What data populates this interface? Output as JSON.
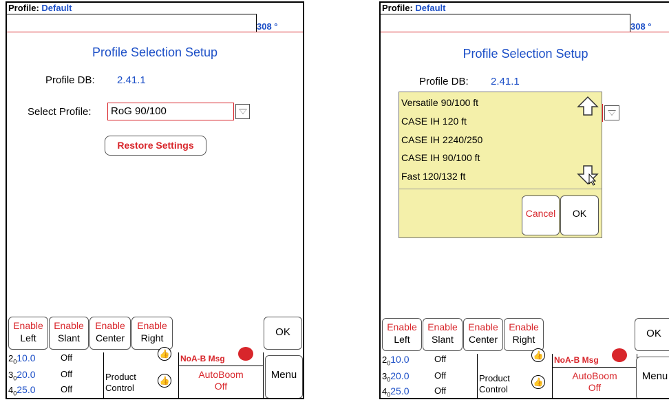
{
  "screens": [
    {
      "header": {
        "profile_label": "Profile:",
        "profile_value": "Default",
        "heading": "308 °"
      },
      "title": "Profile Selection Setup",
      "profile_db": {
        "label": "Profile DB:",
        "value": "2.41.1"
      },
      "select_profile": {
        "label": "Select Profile:",
        "value": "RoG 90/100"
      },
      "restore_label": "Restore Settings",
      "enable_buttons": [
        {
          "top": "Enable",
          "bottom": "Left"
        },
        {
          "top": "Enable",
          "bottom": "Slant"
        },
        {
          "top": "Enable",
          "bottom": "Center"
        },
        {
          "top": "Enable",
          "bottom": "Right"
        }
      ],
      "ok_label": "OK",
      "status": {
        "rows": [
          {
            "idx": "2",
            "sub": "0",
            "val": "10.0",
            "state": "Off"
          },
          {
            "idx": "3",
            "sub": "0",
            "val": "20.0",
            "state": "Off"
          },
          {
            "idx": "4",
            "sub": "0",
            "val": "25.0",
            "state": "Off"
          }
        ],
        "product_control": [
          "Product",
          "Control"
        ],
        "noab_msg": "NoA-B Msg",
        "autoboom": [
          "AutoBoom",
          "Off"
        ],
        "menu_label": "Menu"
      }
    },
    {
      "header": {
        "profile_label": "Profile:",
        "profile_value": "Default",
        "heading": "308 °"
      },
      "title": "Profile Selection Setup",
      "profile_db": {
        "label": "Profile DB:",
        "value": "2.41.1"
      },
      "dropdown_items": [
        "Versatile 90/100 ft",
        "CASE IH 120 ft",
        "CASE IH 2240/250",
        "CASE IH 90/100 ft",
        "Fast 120/132 ft"
      ],
      "cancel_label": "Cancel",
      "dialog_ok_label": "OK",
      "enable_buttons": [
        {
          "top": "Enable",
          "bottom": "Left"
        },
        {
          "top": "Enable",
          "bottom": "Slant"
        },
        {
          "top": "Enable",
          "bottom": "Center"
        },
        {
          "top": "Enable",
          "bottom": "Right"
        }
      ],
      "ok_label": "OK",
      "status": {
        "rows": [
          {
            "idx": "2",
            "sub": "0",
            "val": "10.0",
            "state": "Off"
          },
          {
            "idx": "3",
            "sub": "0",
            "val": "20.0",
            "state": "Off"
          },
          {
            "idx": "4",
            "sub": "0",
            "val": "25.0",
            "state": "Off"
          }
        ],
        "product_control": [
          "Product",
          "Control"
        ],
        "noab_msg": "NoA-B Msg",
        "autoboom": [
          "AutoBoom",
          "Off"
        ],
        "menu_label": "Menu"
      }
    }
  ],
  "colors": {
    "accent_blue": "#1c4fc7",
    "accent_red": "#d8262b",
    "dropdown_bg": "#f4f0aa"
  }
}
